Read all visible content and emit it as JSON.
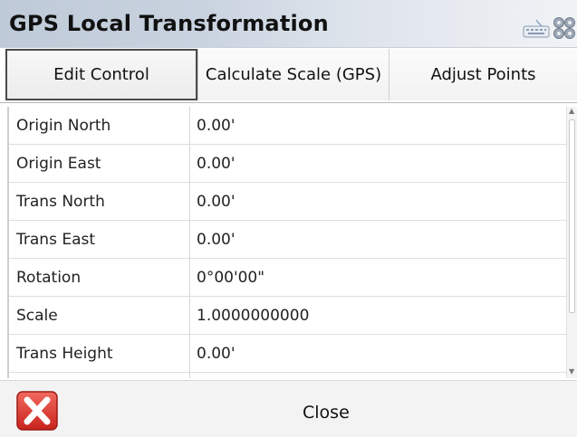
{
  "window": {
    "title": "GPS Local Transformation"
  },
  "tabs": [
    {
      "label": "Edit Control",
      "active": true
    },
    {
      "label": "Calculate Scale (GPS)",
      "active": false
    },
    {
      "label": "Adjust Points",
      "active": false
    }
  ],
  "rows": [
    {
      "label": "Origin North",
      "value": "0.00'"
    },
    {
      "label": "Origin East",
      "value": "0.00'"
    },
    {
      "label": "Trans North",
      "value": "0.00'"
    },
    {
      "label": "Trans East",
      "value": "0.00'"
    },
    {
      "label": "Rotation",
      "value": "0°00'00\""
    },
    {
      "label": "Scale",
      "value": "1.0000000000"
    },
    {
      "label": "Trans Height",
      "value": "0.00'"
    },
    {
      "label": "",
      "value": ""
    }
  ],
  "footer": {
    "close_label": "Close"
  },
  "icons": {
    "keyboard": "keyboard-icon",
    "settings": "settings-icon",
    "close": "close-x-icon"
  },
  "colors": {
    "title_bar_start": "#bfcad8",
    "close_red": "#d9312b"
  }
}
